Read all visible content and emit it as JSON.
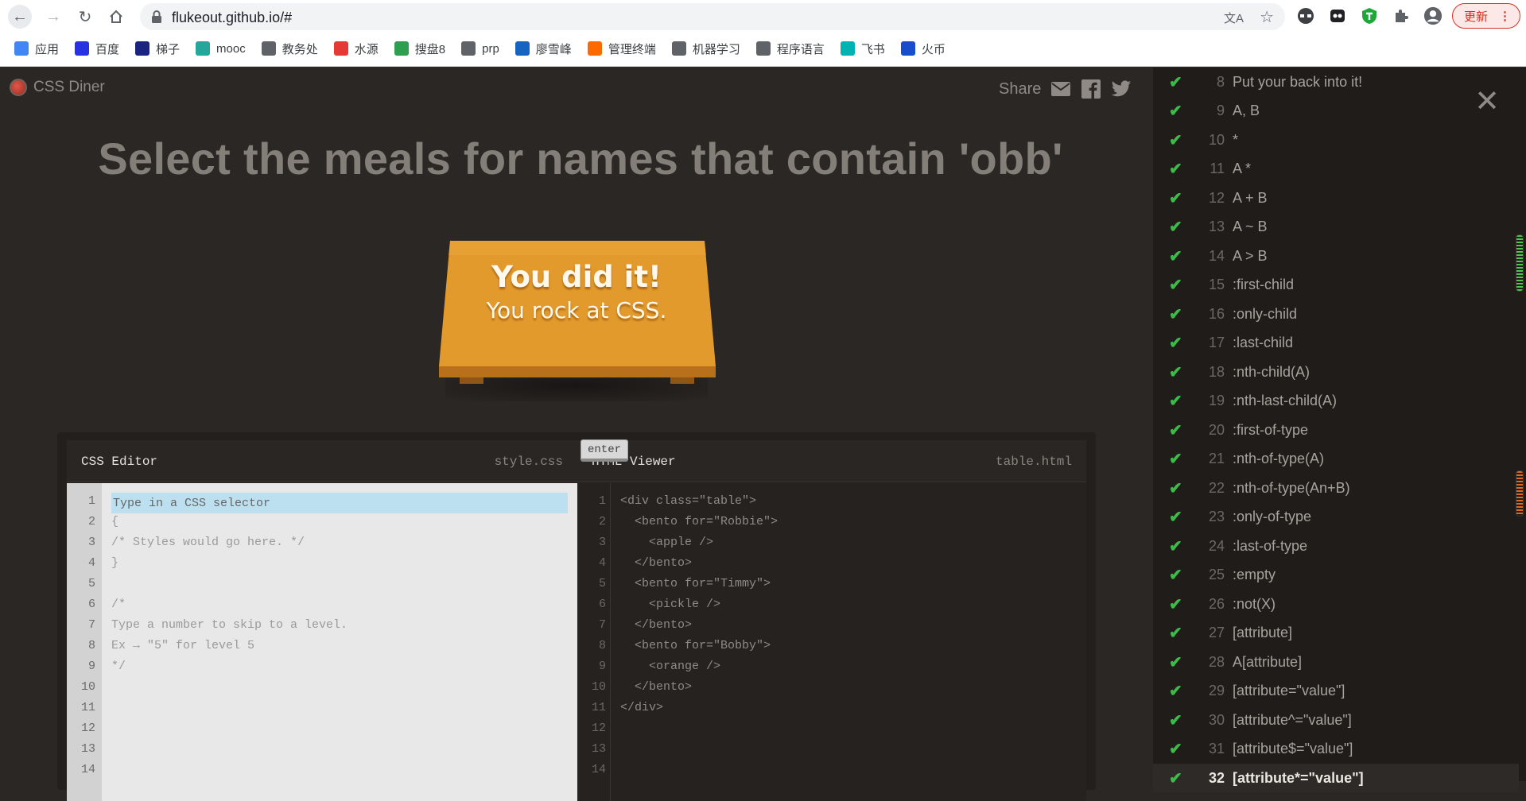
{
  "browser": {
    "url": "flukeout.github.io/#",
    "update_label": "更新",
    "bookmarks": [
      {
        "label": "应用",
        "icon": "apps-grid-icon",
        "color": "#4285f4"
      },
      {
        "label": "百度",
        "icon": "baidu-paw-icon",
        "color": "#2932e1"
      },
      {
        "label": "梯子",
        "icon": "ladder-icon",
        "color": "#1a237e"
      },
      {
        "label": "mooc",
        "icon": "book-icon",
        "color": "#26a69a"
      },
      {
        "label": "教务处",
        "icon": "globe-icon",
        "color": "#5f6368"
      },
      {
        "label": "水源",
        "icon": "shuiyuan-icon",
        "color": "#e53935"
      },
      {
        "label": "搜盘8",
        "icon": "search-square-icon",
        "color": "#2e9e4f"
      },
      {
        "label": "prp",
        "icon": "globe-icon",
        "color": "#5f6368"
      },
      {
        "label": "廖雪峰",
        "icon": "rocket-icon",
        "color": "#1565c0"
      },
      {
        "label": "管理终端",
        "icon": "aliyun-icon",
        "color": "#ff6a00"
      },
      {
        "label": "机器学习",
        "icon": "globe-icon",
        "color": "#5f6368"
      },
      {
        "label": "程序语言",
        "icon": "globe-icon",
        "color": "#5f6368"
      },
      {
        "label": "飞书",
        "icon": "feishu-icon",
        "color": "#00b3b3"
      },
      {
        "label": "火币",
        "icon": "huobi-flame-icon",
        "color": "#1a4dcc"
      }
    ]
  },
  "app": {
    "name": "CSS Diner",
    "share_label": "Share",
    "instruction": "Select the meals for names that contain 'obb'",
    "table_msg_1": "You did it!",
    "table_msg_2": "You rock at CSS."
  },
  "css_editor": {
    "title": "CSS Editor",
    "file": "style.css",
    "placeholder": "Type in a CSS selector",
    "enter_label": "enter",
    "line_numbers": [
      "1",
      "2",
      "3",
      "4",
      "5",
      "6",
      "7",
      "8",
      "9",
      "10",
      "11",
      "12",
      "13",
      "14"
    ],
    "lines": [
      "{",
      "/* Styles would go here. */",
      "}",
      "",
      "/*",
      "Type a number to skip to a level.",
      "Ex → \"5\" for level 5",
      "*/"
    ]
  },
  "html_viewer": {
    "title": "HTML Viewer",
    "file": "table.html",
    "line_numbers": [
      "1",
      "2",
      "3",
      "4",
      "5",
      "6",
      "7",
      "8",
      "9",
      "10",
      "11",
      "12",
      "13",
      "14"
    ],
    "lines": [
      "<div class=\"table\">",
      "  <bento for=\"Robbie\">",
      "    <apple />",
      "  </bento>",
      "  <bento for=\"Timmy\">",
      "    <pickle />",
      "  </bento>",
      "  <bento for=\"Bobby\">",
      "    <orange />",
      "  </bento>",
      "</div>"
    ]
  },
  "levels": [
    {
      "num": "8",
      "name": "Put your back into it!"
    },
    {
      "num": "9",
      "name": "A, B"
    },
    {
      "num": "10",
      "name": "*"
    },
    {
      "num": "11",
      "name": "A  *"
    },
    {
      "num": "12",
      "name": "A + B"
    },
    {
      "num": "13",
      "name": "A ~ B"
    },
    {
      "num": "14",
      "name": "A > B"
    },
    {
      "num": "15",
      "name": ":first-child"
    },
    {
      "num": "16",
      "name": ":only-child"
    },
    {
      "num": "17",
      "name": ":last-child"
    },
    {
      "num": "18",
      "name": ":nth-child(A)"
    },
    {
      "num": "19",
      "name": ":nth-last-child(A)"
    },
    {
      "num": "20",
      "name": ":first-of-type"
    },
    {
      "num": "21",
      "name": ":nth-of-type(A)"
    },
    {
      "num": "22",
      "name": ":nth-of-type(An+B)"
    },
    {
      "num": "23",
      "name": ":only-of-type"
    },
    {
      "num": "24",
      "name": ":last-of-type"
    },
    {
      "num": "25",
      "name": ":empty"
    },
    {
      "num": "26",
      "name": ":not(X)"
    },
    {
      "num": "27",
      "name": "[attribute]"
    },
    {
      "num": "28",
      "name": "A[attribute]"
    },
    {
      "num": "29",
      "name": "[attribute=\"value\"]"
    },
    {
      "num": "30",
      "name": "[attribute^=\"value\"]"
    },
    {
      "num": "31",
      "name": "[attribute$=\"value\"]"
    },
    {
      "num": "32",
      "name": "[attribute*=\"value\"]",
      "current": true
    }
  ],
  "colors": {
    "check": "#3dbb4a",
    "table_orange": "#e3952c",
    "background": "#2b2724"
  }
}
